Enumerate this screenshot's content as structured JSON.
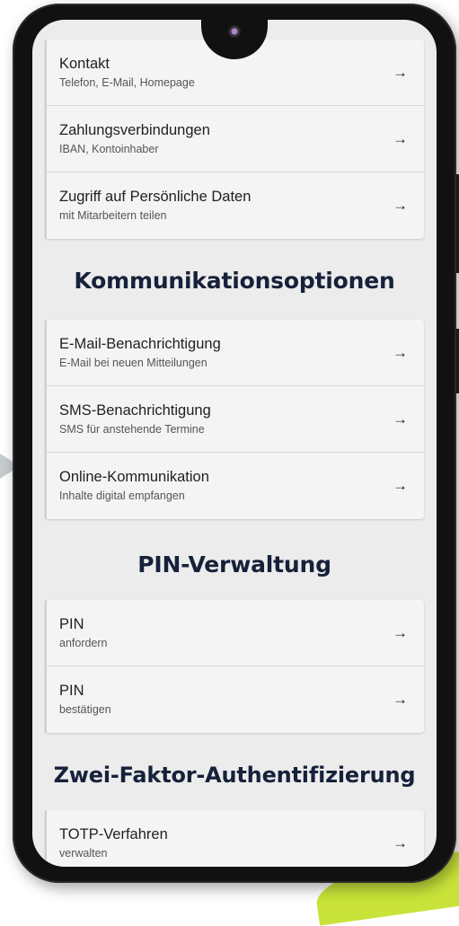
{
  "sections": [
    {
      "title": "",
      "items": [
        {
          "title": "Kontakt",
          "subtitle": "Telefon, E-Mail, Homepage"
        },
        {
          "title": "Zahlungsverbindungen",
          "subtitle": "IBAN, Kontoinhaber"
        },
        {
          "title": "Zugriff auf Persönliche Daten",
          "subtitle": "mit Mitarbeitern teilen"
        }
      ]
    },
    {
      "title": "Kommunikationsoptionen",
      "items": [
        {
          "title": "E-Mail-Benachrichtigung",
          "subtitle": "E-Mail bei neuen Mitteilungen"
        },
        {
          "title": "SMS-Benachrichtigung",
          "subtitle": "SMS für anstehende Termine"
        },
        {
          "title": "Online-Kommunikation",
          "subtitle": "Inhalte digital empfangen"
        }
      ]
    },
    {
      "title": "PIN-Verwaltung",
      "items": [
        {
          "title": "PIN",
          "subtitle": "anfordern"
        },
        {
          "title": "PIN",
          "subtitle": "bestätigen"
        }
      ]
    },
    {
      "title": "Zwei-Faktor-Authentifizierung",
      "items": [
        {
          "title": "TOTP-Verfahren",
          "subtitle": "verwalten"
        }
      ]
    }
  ],
  "arrow_glyph": "→",
  "colors": {
    "heading": "#16213a",
    "card": "#f4f4f4",
    "screen": "#ececec",
    "accent": "#c9e33a"
  }
}
